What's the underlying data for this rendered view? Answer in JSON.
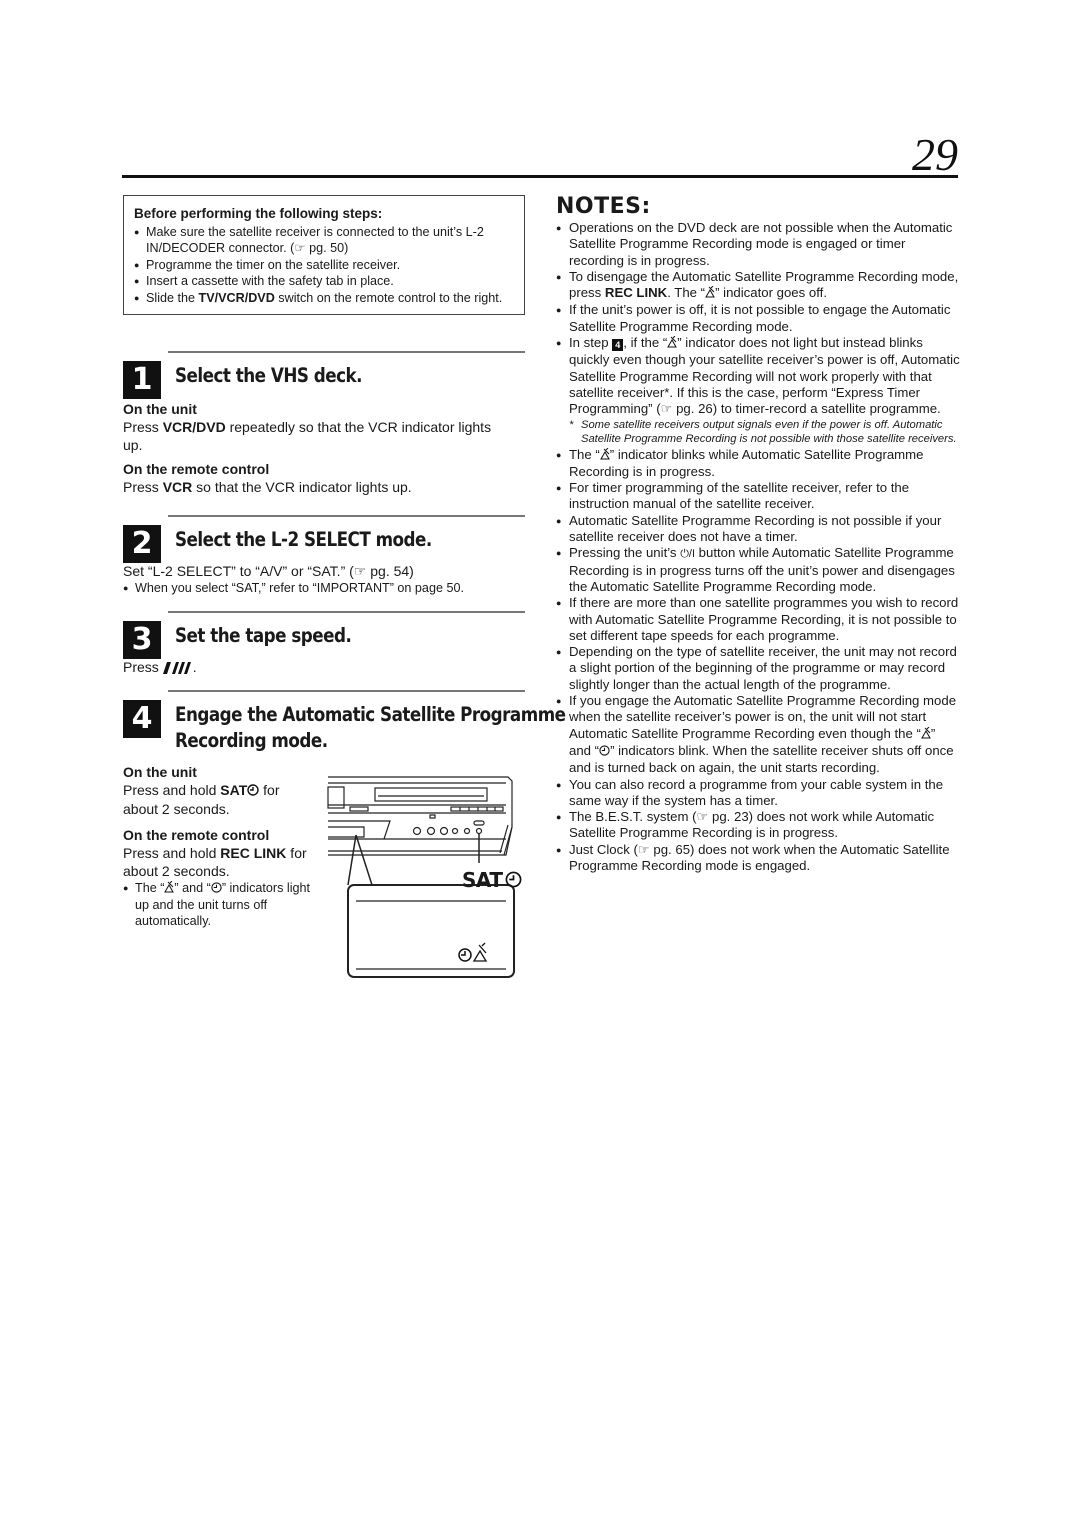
{
  "page_number": "29",
  "before_box": {
    "title": "Before performing the following steps:",
    "items": [
      {
        "pre": "Make sure the satellite receiver is connected to the unit’s L-2 IN/DECODER connector. (",
        "ref_icon": "☞",
        "post": " pg. 50)"
      },
      {
        "pre": "Programme the timer on the satellite receiver."
      },
      {
        "pre": "Insert a cassette with the safety tab in place."
      },
      {
        "pre": "Slide the ",
        "bold": "TV/VCR/DVD",
        "post": " switch on the remote control to the right."
      }
    ]
  },
  "steps": [
    {
      "number": "1",
      "heading": "Select the VHS deck.",
      "unit_label": "On the unit",
      "unit_text_pre": "Press ",
      "unit_text_bold": "VCR/DVD",
      "unit_text_post": " repeatedly so that the VCR indicator lights up.",
      "remote_label": "On the remote control",
      "remote_text_pre": "Press ",
      "remote_text_bold": "VCR",
      "remote_text_post": " so that the VCR indicator lights up."
    },
    {
      "number": "2",
      "heading": "Select the L-2 SELECT mode.",
      "text_pre": "Set “L-2 SELECT” to “A/V” or “SAT.” (",
      "ref_icon": "☞",
      "text_post": " pg. 54)",
      "bullet": "When you select “SAT,” refer to “IMPORTANT” on page 50."
    },
    {
      "number": "3",
      "heading": "Set the tape speed.",
      "text_pre": "Press ",
      "button_glyph": "I/II",
      "text_post": "."
    },
    {
      "number": "4",
      "heading_line1": "Engage the Automatic Satellite Programme",
      "heading_line2": "Recording mode.",
      "unit_label": "On the unit",
      "unit_text_pre": "Press and hold ",
      "unit_text_bold": "SAT",
      "unit_text_post": " for about 2 seconds.",
      "remote_label": "On the remote control",
      "remote_text_pre": "Press and hold ",
      "remote_text_bold": "REC LINK",
      "remote_text_post": " for about 2 seconds.",
      "bullet_pre": "The “",
      "bullet_mid": "” and “",
      "bullet_post": "” indicators light up and the unit turns off automatically."
    }
  ],
  "diagram": {
    "sat_button_label": "SAT"
  },
  "notes": {
    "title": "NOTES:",
    "items": [
      "Operations on the DVD deck are not possible when the Automatic Satellite Programme Recording mode is engaged or timer recording is in progress.",
      {
        "pre": "To disengage the Automatic Satellite Programme Recording mode, press ",
        "bold": "REC LINK",
        "post": ". The “",
        "icon": "satellite",
        "post2": "” indicator goes off."
      },
      "If the unit’s power is off, it is not possible to engage the Automatic Satellite Programme Recording mode.",
      {
        "pre": "In step ",
        "step": "4",
        "mid": ", if the “",
        "icon": "satellite",
        "post": "” indicator does not light but instead blinks quickly even though your satellite receiver’s power is off, Automatic Satellite Programme Recording will not work properly with that satellite receiver*. If this is the case, perform “Express Timer Programming” (",
        "ref": "☞",
        "post2": " pg. 26) to timer-record a satellite programme."
      },
      {
        "footnote": "Some satellite receivers output signals even if the power is off. Automatic Satellite Programme Recording is not possible with those satellite receivers."
      },
      {
        "pre": "The “",
        "icon": "satellite",
        "post": "” indicator blinks while Automatic Satellite Programme Recording is in progress."
      },
      "For timer programming of the satellite receiver, refer to the instruction manual of the satellite receiver.",
      "Automatic Satellite Programme Recording is not possible if your satellite receiver does not have a timer.",
      {
        "pre": "Pressing the unit’s ",
        "power": "⏻/I",
        "post": " button while Automatic Satellite Programme Recording is in progress turns off the unit’s power and disengages the Automatic Satellite Programme Recording mode."
      },
      "If there are more than one satellite programmes you wish to record with Automatic Satellite Programme Recording, it is not possible to set different tape speeds for each programme.",
      "Depending on the type of satellite receiver, the unit may not record a slight portion of the beginning of the programme or may record slightly longer than the actual length of the programme.",
      {
        "pre": "If you engage the Automatic Satellite Programme Recording mode when the satellite receiver’s power is on, the unit will not start Automatic Satellite Programme Recording even though the “",
        "icon": "satellite",
        "mid": "” and “",
        "icon2": "clock",
        "post": "” indicators blink. When the satellite receiver shuts off once and is turned back on again, the unit starts recording."
      },
      "You can also record a programme from your cable system in the same way if the system has a timer.",
      {
        "pre": "The B.E.S.T. system (",
        "ref": "☞",
        "post": " pg. 23) does not work while Automatic Satellite Programme Recording is in progress."
      },
      {
        "pre": "Just Clock (",
        "ref": "☞",
        "post": " pg. 65) does not work when the Automatic Satellite Programme Recording mode is engaged."
      }
    ]
  }
}
